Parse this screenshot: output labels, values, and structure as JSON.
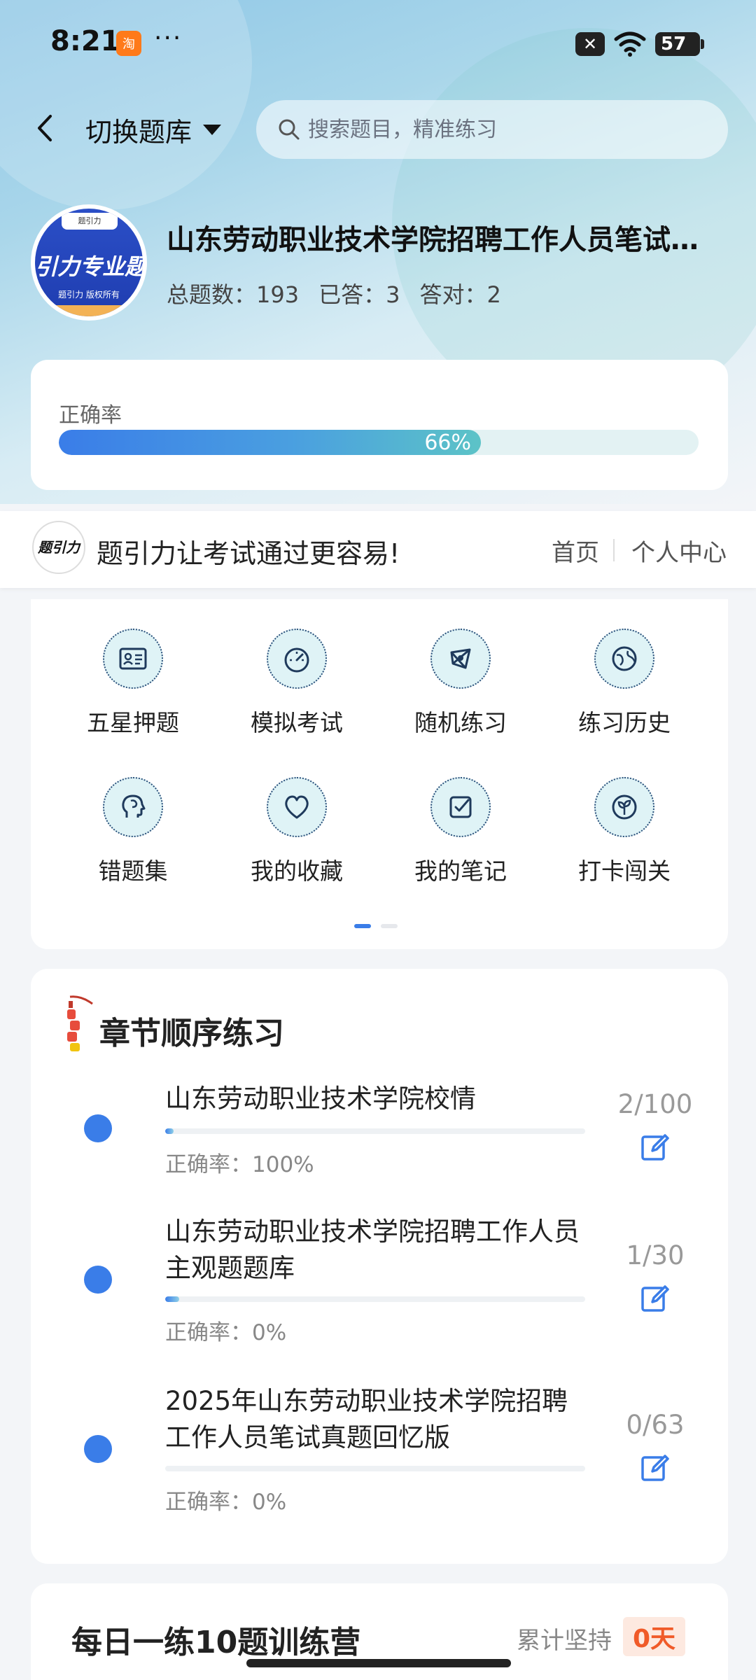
{
  "status_bar": {
    "time": "8:21",
    "app_badge": "淘",
    "more": "···",
    "battery": "57",
    "x_badge": "✕"
  },
  "nav": {
    "back_icon": "chevron-left-icon",
    "bank_switch_label": "切换题库",
    "search_placeholder": "搜索题目，精准练习"
  },
  "book": {
    "cover_text": "引力专业题",
    "cover_tab": "题引力",
    "cover_small": "题引力 版权所有",
    "title": "山东劳动职业技术学院招聘工作人员笔试题库",
    "stats": [
      {
        "label": "总题数：",
        "value": "193"
      },
      {
        "label": "已答：",
        "value": "3"
      },
      {
        "label": "答对：",
        "value": "2"
      }
    ]
  },
  "accuracy": {
    "label": "正确率",
    "value_text": "66%",
    "fraction": 0.66
  },
  "slogan": {
    "logo_text": "题引力",
    "text": "题引力让考试通过更容易!",
    "home_link": "首页",
    "profile_link": "个人中心"
  },
  "features": [
    {
      "label": "五星押题",
      "icon": "id-card-icon"
    },
    {
      "label": "模拟考试",
      "icon": "speedometer-icon"
    },
    {
      "label": "随机练习",
      "icon": "network-icon"
    },
    {
      "label": "练习历史",
      "icon": "globe-icon"
    },
    {
      "label": "错题集",
      "icon": "head-icon"
    },
    {
      "label": "我的收藏",
      "icon": "heart-icon"
    },
    {
      "label": "我的笔记",
      "icon": "checkbox-icon"
    },
    {
      "label": "打卡闯关",
      "icon": "leaf-icon"
    }
  ],
  "chapters": {
    "title": "章节顺序练习",
    "items": [
      {
        "name": "山东劳动职业技术学院校情",
        "accuracy": "正确率：100%",
        "count": "2/100",
        "progress": 0.02
      },
      {
        "name": "山东劳动职业技术学院招聘工作人员 主观题题库",
        "accuracy": "正确率：0%",
        "count": "1/30",
        "progress": 0.033
      },
      {
        "name": "2025年山东劳动职业技术学院招聘工作人员笔试真题回忆版",
        "accuracy": "正确率：0%",
        "count": "0/63",
        "progress": 0
      }
    ]
  },
  "camp": {
    "title": "每日一练10题训练营",
    "keep_label": "累计坚持",
    "days": "0天"
  },
  "colors": {
    "accent": "#3a7de8",
    "teal": "#5cc3c7",
    "days_badge": "#f05a28"
  }
}
